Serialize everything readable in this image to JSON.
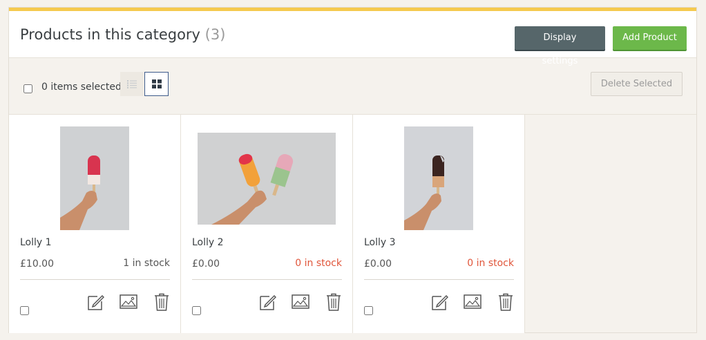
{
  "header": {
    "title": "Products in this category",
    "count": "(3)",
    "display_settings_label": "Display settings",
    "add_product_label": "Add Product"
  },
  "toolbar": {
    "selected_text": "0 items selected",
    "delete_label": "Delete Selected",
    "view_modes": [
      "list-icon",
      "grid-icon"
    ],
    "active_view": "grid"
  },
  "products": [
    {
      "name": "Lolly 1",
      "price": "£10.00",
      "stock": "1 in stock",
      "in_stock": true
    },
    {
      "name": "Lolly 2",
      "price": "£0.00",
      "stock": "0 in stock",
      "in_stock": false
    },
    {
      "name": "Lolly 3",
      "price": "£0.00",
      "stock": "0 in stock",
      "in_stock": false
    }
  ],
  "colors": {
    "accent": "#f5ca4f",
    "add_button": "#6cb84a",
    "display_button": "#56666a",
    "out_of_stock": "#e0553a"
  }
}
